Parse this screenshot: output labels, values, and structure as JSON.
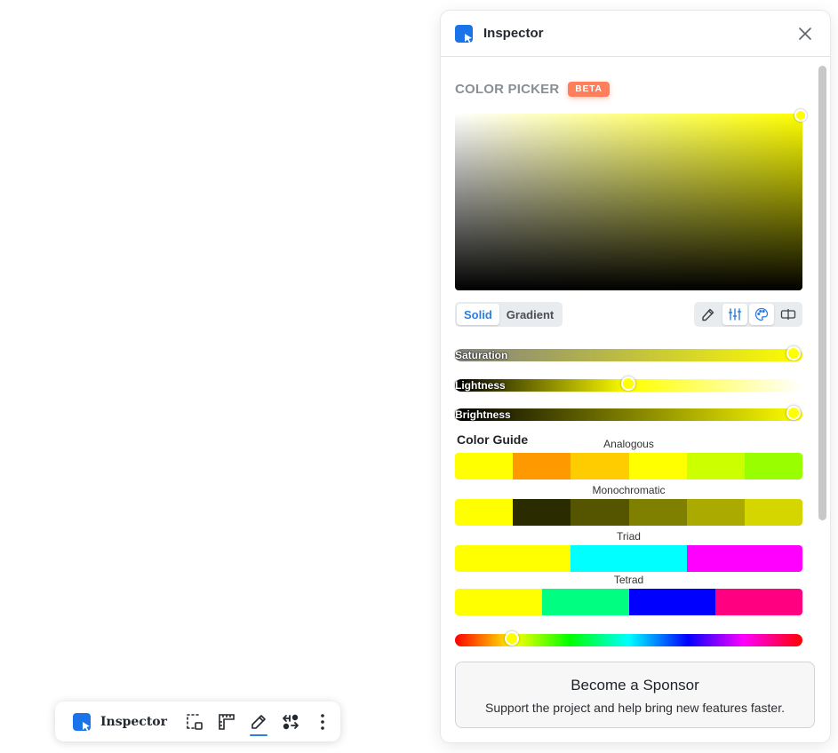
{
  "panel": {
    "title": "Inspector",
    "close_icon": "close-icon"
  },
  "color_picker": {
    "title": "COLOR PICKER",
    "badge": "BETA",
    "current_color": "#ffff00",
    "modes": [
      {
        "label": "Solid",
        "active": true
      },
      {
        "label": "Gradient",
        "active": false
      }
    ],
    "tools": [
      {
        "icon": "eyedropper-icon",
        "active": false
      },
      {
        "icon": "sliders-icon",
        "active": true
      },
      {
        "icon": "palette-icon",
        "active": true
      },
      {
        "icon": "compare-icon",
        "active": false
      }
    ],
    "sliders": {
      "saturation": {
        "label": "Saturation",
        "value": 1.0
      },
      "lightness": {
        "label": "Lightness",
        "value": 0.5
      },
      "brightness": {
        "label": "Brightness",
        "value": 1.0
      }
    },
    "hue_value": 60
  },
  "color_guide": {
    "title": "Color Guide",
    "schemes": [
      {
        "label": "Analogous",
        "colors": [
          "#ffff00",
          "#ff9900",
          "#ffcc00",
          "#ffff00",
          "#ccff00",
          "#99ff00"
        ]
      },
      {
        "label": "Monochromatic",
        "colors": [
          "#ffff00",
          "#2b2b00",
          "#555500",
          "#808000",
          "#aaaa00",
          "#d5d500"
        ]
      },
      {
        "label": "Triad",
        "colors": [
          "#ffff00",
          "#00ffff",
          "#ff00ff"
        ]
      },
      {
        "label": "Tetrad",
        "colors": [
          "#ffff00",
          "#00ff80",
          "#0000ff",
          "#ff0080"
        ]
      }
    ]
  },
  "sponsor": {
    "title": "Become a Sponsor",
    "subtitle": "Support the project and help bring new features faster."
  },
  "toolbar": {
    "title": "Inspector",
    "icons": [
      {
        "icon": "select-area-icon",
        "active": false
      },
      {
        "icon": "ruler-icon",
        "active": false
      },
      {
        "icon": "pen-icon",
        "active": true
      },
      {
        "icon": "swap-icon",
        "active": false
      },
      {
        "icon": "more-vertical-icon",
        "active": false
      }
    ]
  },
  "colors": {
    "accent": "#2f7de1",
    "brand": "#1a73e8",
    "beta_badge": "#ff7f5c"
  }
}
